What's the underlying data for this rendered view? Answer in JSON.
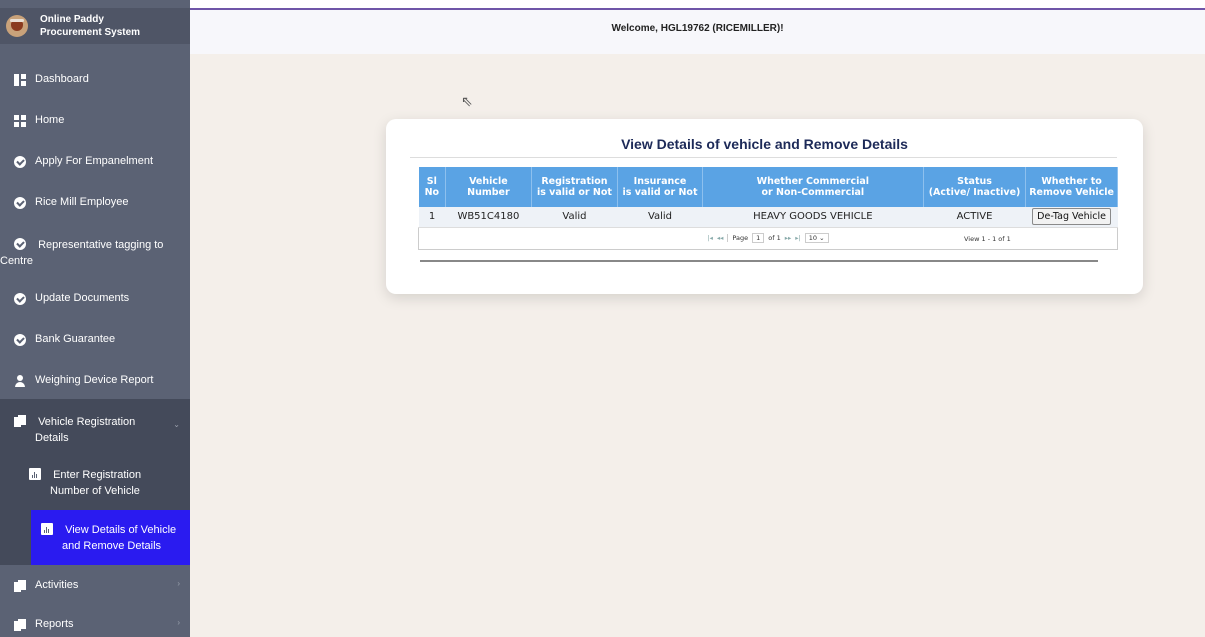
{
  "app": {
    "brand_line1": "Online Paddy",
    "brand_line2": "Procurement System"
  },
  "header": {
    "welcome": "Welcome, HGL19762 (RICEMILLER)!"
  },
  "sidebar": {
    "items": [
      {
        "label": "Dashboard",
        "icon": "dashboard-icon"
      },
      {
        "label": "Home",
        "icon": "grid-icon"
      },
      {
        "label": "Apply For Empanelment",
        "icon": "check-circle-icon"
      },
      {
        "label": "Rice Mill Employee",
        "icon": "check-circle-icon"
      },
      {
        "label": "Representative tagging to",
        "label2": "Centre",
        "icon": "check-circle-icon"
      },
      {
        "label": "Update Documents",
        "icon": "check-circle-icon"
      },
      {
        "label": "Bank Guarantee",
        "icon": "check-circle-icon"
      },
      {
        "label": "Weighing Device Report",
        "icon": "user-icon"
      },
      {
        "label": "Vehicle Registration",
        "label2": "Details",
        "icon": "documents-icon"
      },
      {
        "label": "Enter Registration",
        "label2": "Number of Vehicle",
        "icon": "chart-icon"
      },
      {
        "label": "View Details of Vehicle",
        "label2": "and Remove Details",
        "icon": "chart-icon"
      },
      {
        "label": "Activities",
        "icon": "documents-icon"
      },
      {
        "label": "Reports",
        "icon": "documents-icon"
      }
    ]
  },
  "main": {
    "title": "View Details of vehicle and Remove Details",
    "table": {
      "headers": [
        {
          "l1": "Sl No",
          "l2": ""
        },
        {
          "l1": "Vehicle",
          "l2": "Number"
        },
        {
          "l1": "Registration",
          "l2": "is valid or Not"
        },
        {
          "l1": "Insurance",
          "l2": "is valid or Not"
        },
        {
          "l1": "Whether Commercial",
          "l2": "or Non-Commercial"
        },
        {
          "l1": "Status",
          "l2": "(Active/ Inactive)"
        },
        {
          "l1": "Whether to",
          "l2": "Remove Vehicle"
        }
      ],
      "rows": [
        {
          "sl": "1",
          "vehicle": "WB51C4180",
          "registration": "Valid",
          "insurance": "Valid",
          "commercial": "HEAVY GOODS VEHICLE",
          "status": "ACTIVE",
          "action": "De-Tag Vehicle"
        }
      ],
      "pager": {
        "page_label": "Page",
        "page_value": "1",
        "of_label": "of 1",
        "page_size": "10",
        "view_info": "View 1 - 1 of 1"
      }
    }
  },
  "colors": {
    "sidebar_bg": "#5b6274",
    "active_bg": "#2a1bf0",
    "table_header": "#5aa3e4",
    "title_color": "#1d2a58"
  }
}
